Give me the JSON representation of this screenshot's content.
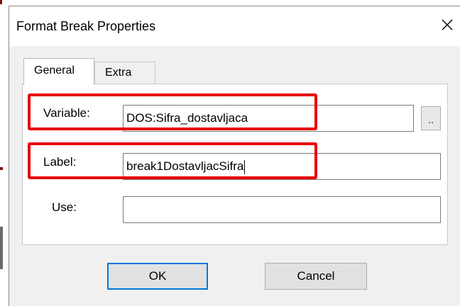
{
  "window": {
    "title": "Format Break Properties",
    "close_icon": "close-icon"
  },
  "tabs": [
    {
      "label": "General",
      "selected": true
    },
    {
      "label": "Extra",
      "selected": false
    }
  ],
  "form": {
    "variable": {
      "label": "Variable:",
      "value": "DOS:Sifra_dostavljaca",
      "browse_label": "..",
      "highlighted": true
    },
    "label": {
      "label": "Label:",
      "value": "break1DostavljacSifra",
      "highlighted": true
    },
    "use": {
      "label": "Use:",
      "value": ""
    }
  },
  "buttons": {
    "ok": "OK",
    "cancel": "Cancel"
  },
  "colors": {
    "highlight": "#e8000b",
    "focus_border": "#0078d7",
    "dialog_bg": "#f0f0f0"
  }
}
